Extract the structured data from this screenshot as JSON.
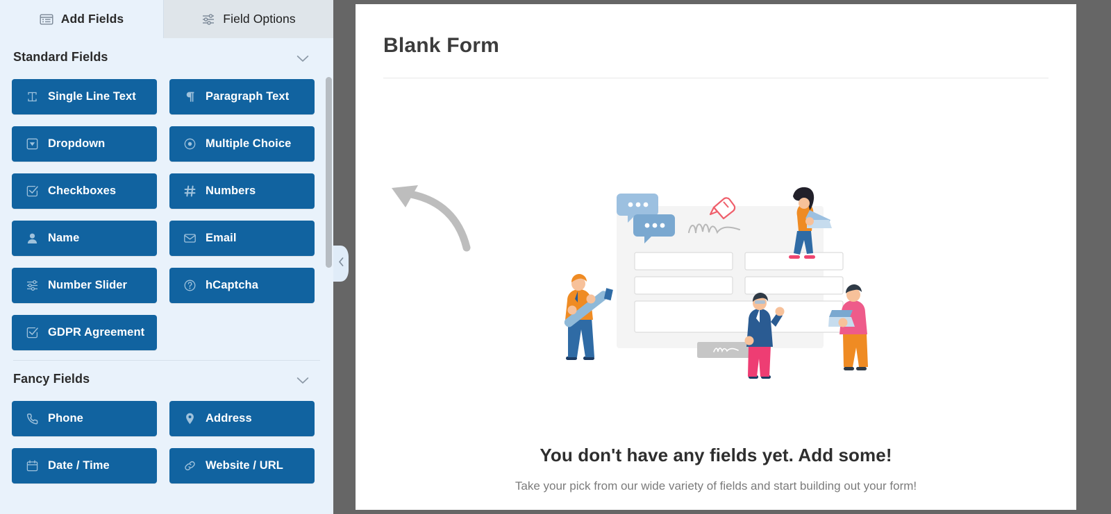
{
  "sidebar": {
    "tabs": [
      {
        "label": "Add Fields",
        "icon": "list-panel-icon",
        "active": true
      },
      {
        "label": "Field Options",
        "icon": "sliders-icon",
        "active": false
      }
    ],
    "sections": [
      {
        "title": "Standard Fields",
        "toggle_icon": "chevron-down-icon",
        "fields": [
          {
            "label": "Single Line Text",
            "icon": "text-cursor-icon"
          },
          {
            "label": "Paragraph Text",
            "icon": "pilcrow-icon"
          },
          {
            "label": "Dropdown",
            "icon": "dropdown-caret-icon"
          },
          {
            "label": "Multiple Choice",
            "icon": "radio-button-icon"
          },
          {
            "label": "Checkboxes",
            "icon": "checkbox-icon"
          },
          {
            "label": "Numbers",
            "icon": "hash-icon"
          },
          {
            "label": "Name",
            "icon": "user-icon"
          },
          {
            "label": "Email",
            "icon": "envelope-icon"
          },
          {
            "label": "Number Slider",
            "icon": "sliders-icon"
          },
          {
            "label": "hCaptcha",
            "icon": "question-circle-icon"
          },
          {
            "label": "GDPR Agreement",
            "icon": "checkbox-icon"
          }
        ]
      },
      {
        "title": "Fancy Fields",
        "toggle_icon": "chevron-down-icon",
        "fields": [
          {
            "label": "Phone",
            "icon": "phone-icon"
          },
          {
            "label": "Address",
            "icon": "map-pin-icon"
          },
          {
            "label": "Date / Time",
            "icon": "calendar-icon"
          },
          {
            "label": "Website / URL",
            "icon": "link-icon"
          }
        ]
      }
    ],
    "scrollbar": {
      "name": "sidebar-scrollbar"
    }
  },
  "collapse": {
    "icon": "chevron-left-icon",
    "label": ""
  },
  "main": {
    "form_title": "Blank Form",
    "empty_state": {
      "heading": "You don't have any fields yet. Add some!",
      "subtext": "Take your pick from our wide variety of fields and start building out your form!",
      "illustration": "form-builder-illustration",
      "arrow": "curved-arrow-pointing-left"
    }
  },
  "colors": {
    "field_button": "#1163a0",
    "sidebar_bg": "#e9f2fb",
    "tab_inactive_bg": "#dfe5ea",
    "page_bg": "#666666",
    "panel_bg": "#ffffff"
  }
}
